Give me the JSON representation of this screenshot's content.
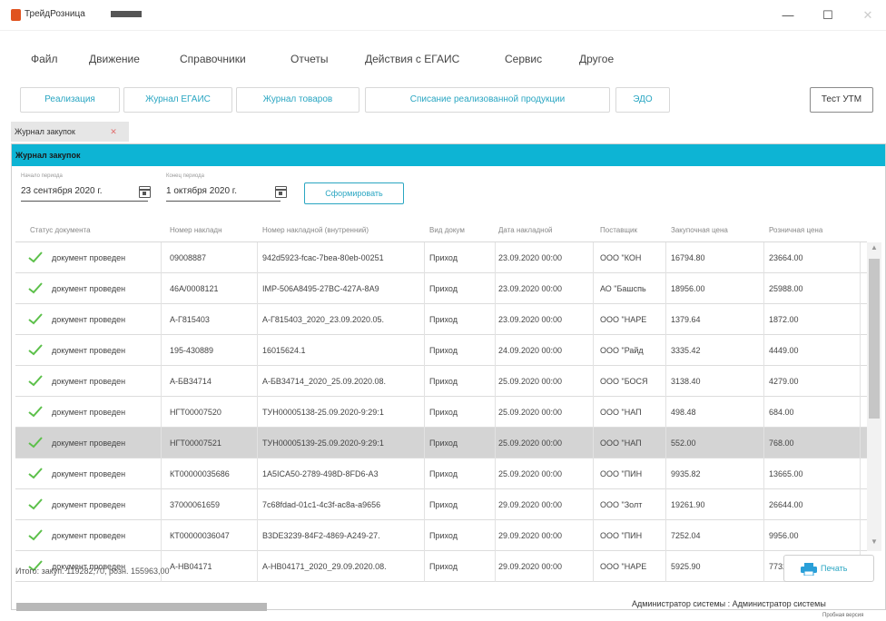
{
  "window": {
    "title": "ТрейдРозница",
    "minimize": "—",
    "maximize": "☐",
    "close": "✕"
  },
  "menu": [
    "Файл",
    "Движение",
    "Справочники",
    "Отчеты",
    "Действия с ЕГАИС",
    "Сервис",
    "Другое"
  ],
  "toolbar": {
    "buttons": [
      "Реализация",
      "Журнал ЕГАИС",
      "Журнал товаров",
      "Списание реализованной продукции",
      "ЭДО"
    ],
    "right_button": "Тест УТМ"
  },
  "doc_tab": {
    "label": "Журнал закупок",
    "close": "✕"
  },
  "panel": {
    "title": "Журнал закупок",
    "period_start": {
      "label": "Начало периода",
      "value": "23 сентября 2020 г."
    },
    "period_end": {
      "label": "Конец периода",
      "value": "1 октября 2020 г."
    },
    "form_button": "Сформировать"
  },
  "table": {
    "headers": [
      "Статус документа",
      "Номер накладн",
      "Номер накладной (внутренний)",
      "Вид докум",
      "Дата накладной",
      "Поставщик",
      "Закупочная цена",
      "Розничная цена"
    ],
    "rows": [
      {
        "status": "документ проведен",
        "num": "09008887",
        "internal": "942d5923-fcac-7bea-80eb-00251",
        "type": "Приход",
        "date": "23.09.2020 00:00",
        "supplier": "ООО \"КОН",
        "purchase": "16794.80",
        "retail": "23664.00"
      },
      {
        "status": "документ проведен",
        "num": "46А/0008121",
        "internal": "IMP-506A8495-27BC-427A-8A9",
        "type": "Приход",
        "date": "23.09.2020 00:00",
        "supplier": "АО \"Башспь",
        "purchase": "18956.00",
        "retail": "25988.00"
      },
      {
        "status": "документ проведен",
        "num": "А-Г815403",
        "internal": "А-Г815403_2020_23.09.2020.05.",
        "type": "Приход",
        "date": "23.09.2020 00:00",
        "supplier": "ООО \"НАРЕ",
        "purchase": "1379.64",
        "retail": "1872.00"
      },
      {
        "status": "документ проведен",
        "num": "195-430889",
        "internal": "16015624.1",
        "type": "Приход",
        "date": "24.09.2020 00:00",
        "supplier": "ООО \"Райд",
        "purchase": "3335.42",
        "retail": "4449.00"
      },
      {
        "status": "документ проведен",
        "num": "А-БВ34714",
        "internal": "А-БВ34714_2020_25.09.2020.08.",
        "type": "Приход",
        "date": "25.09.2020 00:00",
        "supplier": "ООО \"БОСЯ",
        "purchase": "3138.40",
        "retail": "4279.00"
      },
      {
        "status": "документ проведен",
        "num": "НГТ00007520",
        "internal": "ТУН00005138-25.09.2020-9:29:1",
        "type": "Приход",
        "date": "25.09.2020 00:00",
        "supplier": "ООО \"НАП",
        "purchase": "498.48",
        "retail": "684.00"
      },
      {
        "status": "документ проведен",
        "num": "НГТ00007521",
        "internal": "ТУН00005139-25.09.2020-9:29:1",
        "type": "Приход",
        "date": "25.09.2020 00:00",
        "supplier": "ООО \"НАП",
        "purchase": "552.00",
        "retail": "768.00"
      },
      {
        "status": "документ проведен",
        "num": "КТ00000035686",
        "internal": "1A5ICA50-2789-498D-8FD6-A3",
        "type": "Приход",
        "date": "25.09.2020 00:00",
        "supplier": "ООО \"ПИН",
        "purchase": "9935.82",
        "retail": "13665.00"
      },
      {
        "status": "документ проведен",
        "num": "37000061659",
        "internal": "7c68fdad-01c1-4c3f-ac8a-a9656",
        "type": "Приход",
        "date": "29.09.2020 00:00",
        "supplier": "ООО \"Золт",
        "purchase": "19261.90",
        "retail": "26644.00"
      },
      {
        "status": "документ проведен",
        "num": "КТ00000036047",
        "internal": "B3DE3239-84F2-4869-A249-27.",
        "type": "Приход",
        "date": "29.09.2020 00:00",
        "supplier": "ООО \"ПИН",
        "purchase": "7252.04",
        "retail": "9956.00"
      },
      {
        "status": "документ проведен",
        "num": "А-НВ04171",
        "internal": "А-НВ04171_2020_29.09.2020.08.",
        "type": "Приход",
        "date": "29.09.2020 00:00",
        "supplier": "ООО \"НАРЕ",
        "purchase": "5925.90",
        "retail": "7732.00"
      }
    ],
    "selected_row": 6
  },
  "totals": "Итого: закуп. 119282,70, розн. 155963,00",
  "print_button": "Печать",
  "status": {
    "user": "Администратор системы : Администратор системы",
    "version": "Пробная версия"
  },
  "colors": {
    "accent": "#0db4d4",
    "link": "#2aa6c2",
    "check": "#5cc04a",
    "selected": "#d4d4d4"
  }
}
